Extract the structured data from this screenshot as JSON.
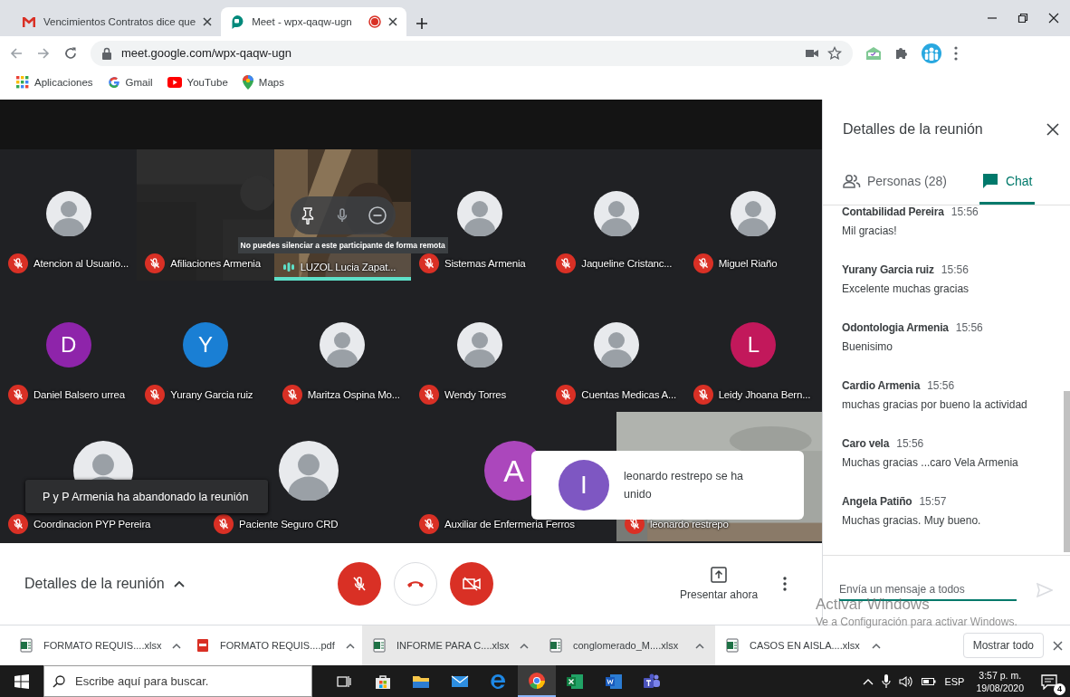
{
  "browser": {
    "tabs": [
      {
        "title": "Vencimientos Contratos dice que",
        "kind": "gmail",
        "selected": false,
        "recording": false
      },
      {
        "title": "Meet - wpx-qaqw-ugn",
        "kind": "meet",
        "selected": true,
        "recording": true
      }
    ],
    "url": "meet.google.com/wpx-qaqw-ugn",
    "bookmarks": [
      {
        "label": "Aplicaciones",
        "kind": "apps"
      },
      {
        "label": "Gmail",
        "kind": "google"
      },
      {
        "label": "YouTube",
        "kind": "youtube"
      },
      {
        "label": "Maps",
        "kind": "maps"
      }
    ]
  },
  "meeting": {
    "tile_rows": [
      [
        {
          "name": "Atencion al Usuario...",
          "kind": "avatar",
          "muted": true,
          "hovered": false
        },
        {
          "name": "Afiliaciones Armenia",
          "kind": "video",
          "muted": true,
          "hovered": false
        },
        {
          "name": "LUZOL Lucia Zapat...",
          "kind": "video",
          "muted": false,
          "hovered": true
        },
        {
          "name": "Sistemas Armenia",
          "kind": "avatar",
          "muted": true,
          "hovered": false
        },
        {
          "name": "Jaqueline Cristanc...",
          "kind": "avatar",
          "muted": true,
          "hovered": false
        },
        {
          "name": "Miguel Riaño",
          "kind": "avatar",
          "muted": true,
          "hovered": false
        }
      ],
      [
        {
          "name": "Daniel Balsero urrea",
          "kind": "letter",
          "letter": "D",
          "color": "#8e24aa",
          "muted": true,
          "hovered": false
        },
        {
          "name": "Yurany Garcia ruiz",
          "kind": "letter",
          "letter": "Y",
          "color": "#1a7fd4",
          "muted": true,
          "hovered": false
        },
        {
          "name": "Maritza Ospina Mo...",
          "kind": "avatar",
          "muted": true,
          "hovered": false
        },
        {
          "name": "Wendy Torres",
          "kind": "avatar",
          "muted": true,
          "hovered": false
        },
        {
          "name": "Cuentas Medicas A...",
          "kind": "avatar",
          "muted": true,
          "hovered": false
        },
        {
          "name": "Leidy Jhoana Bern...",
          "kind": "letter",
          "letter": "L",
          "color": "#c2185b",
          "muted": true,
          "hovered": false
        }
      ],
      [
        {
          "name": "Coordinacion PYP Pereira",
          "kind": "avatar",
          "muted": true,
          "hovered": false
        },
        {
          "name": "Paciente Seguro CRD",
          "kind": "avatar",
          "muted": true,
          "hovered": false
        },
        {
          "name": "Auxiliar de Enfermeria Ferros",
          "kind": "letter",
          "letter": "A",
          "color": "#ab47bc",
          "muted": true,
          "hovered": false
        },
        {
          "name": "leonardo restrepo",
          "kind": "video",
          "muted": true,
          "hovered": false
        }
      ]
    ],
    "hover_tooltip": "No puedes silenciar a este participante de forma remota",
    "left_notice": "P y P Armenia ha abandonado la reunión",
    "join_notice": {
      "letter": "I",
      "color": "#7e57c2",
      "text": "leonardo restrepo se ha unido"
    },
    "details_label": "Detalles de la reunión",
    "mic_on": false,
    "camera_on": false,
    "present_label": "Presentar ahora"
  },
  "panel": {
    "title": "Detalles de la reunión",
    "tabs": [
      {
        "label": "Personas (28)",
        "kind": "people",
        "selected": false
      },
      {
        "label": "Chat",
        "kind": "chat",
        "selected": true
      }
    ],
    "messages": [
      {
        "sender": "Contabilidad Pereira",
        "time": "15:56",
        "text": "Mil gracias!"
      },
      {
        "sender": "Yurany Garcia ruiz",
        "time": "15:56",
        "text": "Excelente muchas gracias"
      },
      {
        "sender": "Odontologia Armenia",
        "time": "15:56",
        "text": "Buenisimo"
      },
      {
        "sender": "Cardio Armenia",
        "time": "15:56",
        "text": "muchas gracias por bueno la actividad"
      },
      {
        "sender": "Caro vela",
        "time": "15:56",
        "text": "Muchas gracias ...caro Vela Armenia"
      },
      {
        "sender": "Angela Patiño",
        "time": "15:57",
        "text": "Muchas gracias. Muy bueno."
      }
    ],
    "input_placeholder": "Envía un mensaje a todos"
  },
  "downloads": {
    "items": [
      {
        "name": "FORMATO REQUIS....xlsx",
        "kind": "xlsx",
        "highlighted": false
      },
      {
        "name": "FORMATO REQUIS....pdf",
        "kind": "pdf",
        "highlighted": false
      },
      {
        "name": "INFORME PARA C....xlsx",
        "kind": "xlsx",
        "highlighted": true
      },
      {
        "name": "conglomerado_M....xlsx",
        "kind": "xlsx",
        "highlighted": true
      },
      {
        "name": "CASOS EN AISLA....xlsx",
        "kind": "xlsx",
        "highlighted": false
      }
    ],
    "show_all": "Mostrar todo"
  },
  "activation_notice": {
    "title": "Activar Windows",
    "text": "Ve a Configuración para activar Windows."
  },
  "taskbar": {
    "search_placeholder": "Escribe aquí para buscar.",
    "apps": [
      {
        "kind": "taskview",
        "active": false
      },
      {
        "kind": "store",
        "active": false
      },
      {
        "kind": "explorer",
        "active": false
      },
      {
        "kind": "mail",
        "active": false
      },
      {
        "kind": "edge",
        "active": false
      },
      {
        "kind": "chrome",
        "active": true
      },
      {
        "kind": "excel",
        "active": false
      },
      {
        "kind": "word",
        "active": false
      },
      {
        "kind": "teams",
        "active": false
      }
    ],
    "language": "ESP",
    "time": "3:57 p. m.",
    "date": "19/08/2020",
    "notifications": "4"
  }
}
